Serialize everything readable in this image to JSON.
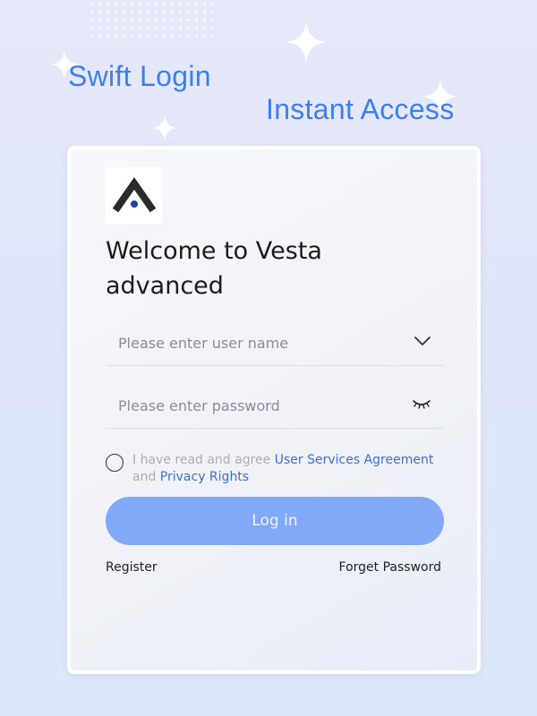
{
  "headlines": {
    "line1": "Swift Login",
    "line2": "Instant Access"
  },
  "card": {
    "logo_icon": "vesta-logo-icon",
    "welcome_title": "Welcome to Vesta advanced",
    "username": {
      "value": "",
      "placeholder": "Please enter user name",
      "icon": "chevron-down-icon"
    },
    "password": {
      "value": "",
      "placeholder": "Please enter password",
      "icon": "eye-closed-icon"
    },
    "agreement": {
      "checked": false,
      "prefix": "I have read and agree ",
      "link_terms": "User Services Agreement",
      "connector": " and ",
      "link_privacy": "Privacy Rights"
    },
    "login_button": "Log in",
    "register_link": "Register",
    "forget_password_link": "Forget Password"
  },
  "colors": {
    "accent_text": "#3d7ff2",
    "link": "#3d6fd1",
    "button_bg": "#82a9f8",
    "logo_dark": "#2b2b2b",
    "logo_dot": "#1f3fb3"
  }
}
